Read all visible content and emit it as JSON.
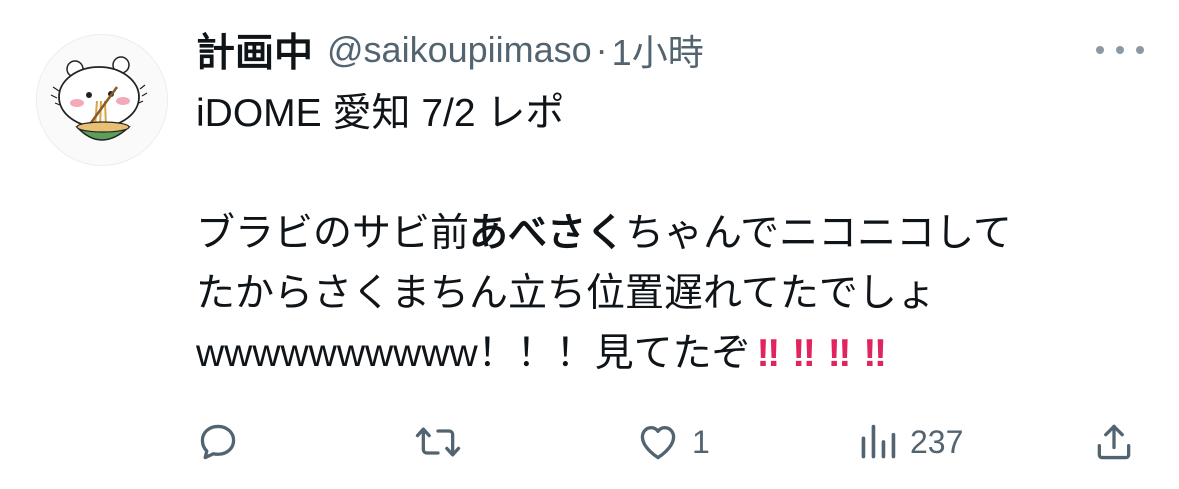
{
  "tweet": {
    "display_name": "計画中",
    "handle": "@saikoupiimaso",
    "separator": "·",
    "time": "1小時",
    "body": {
      "line1": "iDOME 愛知 7/2 レポ",
      "line3_pre": "ブラビのサビ前",
      "line3_bold": "あべさく",
      "line3_post": "ちゃんでニコニコして",
      "line4": "たからさくまちん立ち位置遅れてたでしょ",
      "line5": "wwwwwwwwww！！！見てたぞ",
      "bangs": [
        "‼",
        "‼",
        "‼",
        "‼"
      ]
    }
  },
  "actions": {
    "reply": {
      "icon": "reply-icon",
      "count": ""
    },
    "retweet": {
      "icon": "retweet-icon",
      "count": ""
    },
    "like": {
      "icon": "heart-icon",
      "count": "1"
    },
    "views": {
      "icon": "views-icon",
      "count": "237"
    },
    "share": {
      "icon": "share-icon",
      "count": ""
    }
  },
  "colors": {
    "text": "#0f1419",
    "secondary": "#536471",
    "accent_red": "#e0245e"
  }
}
